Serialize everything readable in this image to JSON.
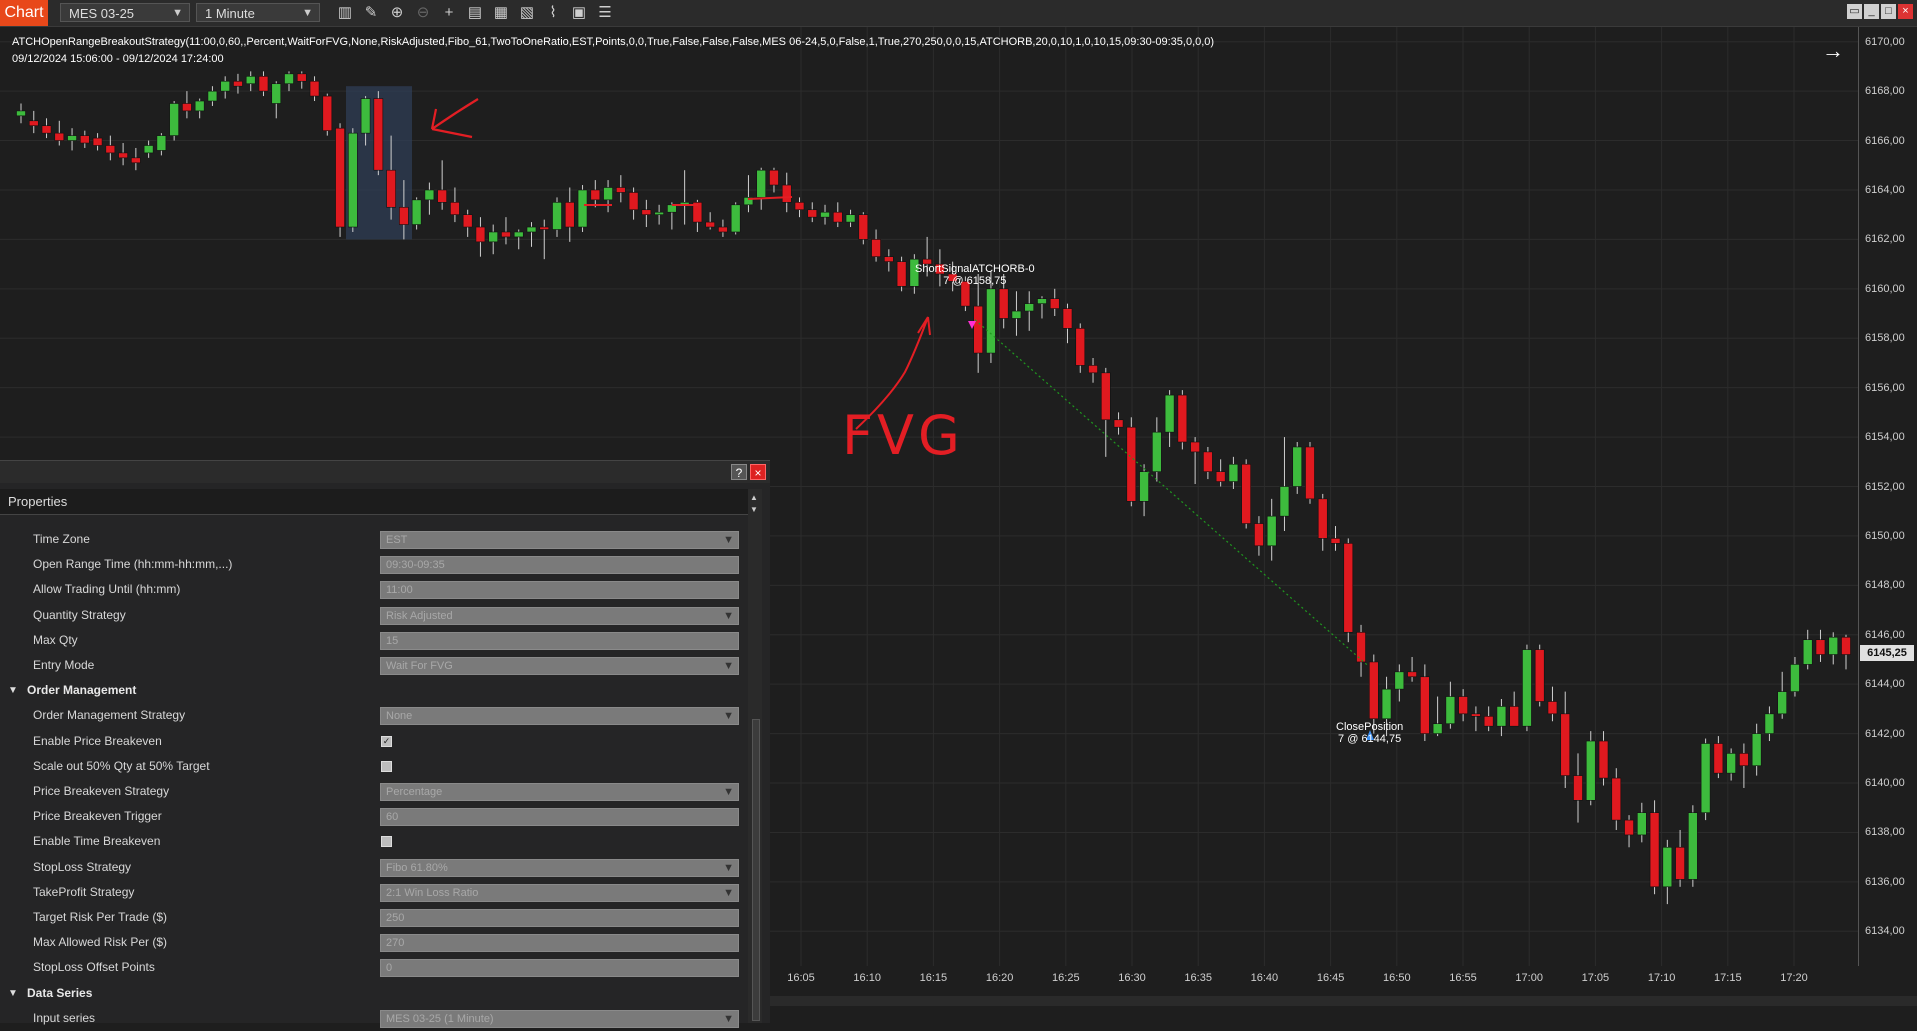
{
  "toolbar": {
    "chart_tab": "Chart",
    "instrument": "MES 03-25",
    "interval": "1 Minute",
    "icons": [
      "bar-style-icon",
      "draw-tool-icon",
      "zoom-in-icon",
      "zoom-out-icon",
      "crosshair-icon",
      "data-box-icon",
      "chart-trader-icon",
      "indicators-icon",
      "strategies-icon",
      "properties-icon",
      "menu-icon"
    ]
  },
  "chart": {
    "strategy_label": "ATCHOpenRangeBreakoutStrategy(11:00,0,60,,Percent,WaitForFVG,None,RiskAdjusted,Fibo_61,TwoToOneRatio,EST,Points,0,0,True,False,False,False,MES 06-24,5,0,False,1,True,270,250,0,0,15,ATCHORB,20,0,10,1,0,10,15,09:30-09:35,0,0,0)",
    "date_range": "09/12/2024 15:06:00 - 09/12/2024 17:24:00",
    "entry_label_1": "ShortSignalATCHORB-0",
    "entry_label_2": "7 @ 6158,75",
    "exit_label_1": "ClosePosition",
    "exit_label_2": "7 @ 6144,75",
    "handwritten_note": "FVG",
    "last_price": "6145,25",
    "colors": {
      "up": "#3dbb3d",
      "down": "#e0191f",
      "annotation": "#e31e24",
      "background": "#1e1e1e",
      "highlight_box": "#2f3d55"
    }
  },
  "chart_data": {
    "type": "candlestick",
    "ylim": [
      6133,
      6171
    ],
    "y_ticks": [
      "6170,00",
      "6168,00",
      "6166,00",
      "6164,00",
      "6162,00",
      "6160,00",
      "6158,00",
      "6156,00",
      "6154,00",
      "6152,00",
      "6150,00",
      "6148,00",
      "6146,00",
      "6144,00",
      "6142,00",
      "6140,00",
      "6138,00",
      "6136,00",
      "6134,00"
    ],
    "x_ticks": [
      "16:05",
      "16:10",
      "16:15",
      "16:20",
      "16:25",
      "16:30",
      "16:35",
      "16:40",
      "16:45",
      "16:50",
      "16:55",
      "17:00",
      "17:05",
      "17:10",
      "17:15",
      "17:20"
    ],
    "ohlc": [
      [
        6167,
        6167.5,
        6166.7,
        6167.2
      ],
      [
        6166.8,
        6167.2,
        6166.3,
        6166.6
      ],
      [
        6166.6,
        6166.9,
        6166.1,
        6166.3
      ],
      [
        6166.3,
        6166.8,
        6165.8,
        6166
      ],
      [
        6166,
        6166.5,
        6165.6,
        6166.2
      ],
      [
        6166.2,
        6166.4,
        6165.7,
        6165.9
      ],
      [
        6166.1,
        6166.3,
        6165.6,
        6165.8
      ],
      [
        6165.8,
        6166.2,
        6165.2,
        6165.5
      ],
      [
        6165.5,
        6165.9,
        6165,
        6165.3
      ],
      [
        6165.3,
        6165.7,
        6164.8,
        6165.1
      ],
      [
        6165.5,
        6166,
        6165.3,
        6165.8
      ],
      [
        6165.6,
        6166.3,
        6165.4,
        6166.2
      ],
      [
        6166.2,
        6167.6,
        6166,
        6167.5
      ],
      [
        6167.5,
        6168,
        6166.9,
        6167.2
      ],
      [
        6167.2,
        6167.7,
        6166.9,
        6167.6
      ],
      [
        6167.6,
        6168.2,
        6167.4,
        6168
      ],
      [
        6168,
        6168.6,
        6167.7,
        6168.4
      ],
      [
        6168.4,
        6168.7,
        6167.9,
        6168.2
      ],
      [
        6168.3,
        6168.8,
        6168,
        6168.6
      ],
      [
        6168.6,
        6168.8,
        6167.8,
        6168
      ],
      [
        6167.5,
        6168.4,
        6166.9,
        6168.3
      ],
      [
        6168.3,
        6168.8,
        6168,
        6168.7
      ],
      [
        6168.7,
        6168.8,
        6168.1,
        6168.4
      ],
      [
        6168.4,
        6168.6,
        6167.6,
        6167.8
      ],
      [
        6167.8,
        6167.9,
        6166.2,
        6166.4
      ],
      [
        6166.5,
        6166.7,
        6162.1,
        6162.5
      ],
      [
        6162.5,
        6166.5,
        6162.3,
        6166.3
      ],
      [
        6166.3,
        6167.8,
        6165.8,
        6167.7
      ],
      [
        6167.7,
        6168,
        6164.6,
        6164.8
      ],
      [
        6164.8,
        6166.2,
        6162.8,
        6163.3
      ],
      [
        6163.3,
        6164.4,
        6162,
        6162.6
      ],
      [
        6162.6,
        6163.7,
        6162.4,
        6163.6
      ],
      [
        6163.6,
        6164.3,
        6163,
        6164
      ],
      [
        6164,
        6165.2,
        6163.2,
        6163.5
      ],
      [
        6163.5,
        6164.1,
        6162.7,
        6163
      ],
      [
        6163,
        6163.2,
        6162.1,
        6162.5
      ],
      [
        6162.5,
        6162.9,
        6161.3,
        6161.9
      ],
      [
        6161.9,
        6162.6,
        6161.4,
        6162.3
      ],
      [
        6162.3,
        6162.9,
        6161.8,
        6162.1
      ],
      [
        6162.1,
        6162.4,
        6161.6,
        6162.3
      ],
      [
        6162.3,
        6162.7,
        6161.7,
        6162.5
      ],
      [
        6162.5,
        6162.8,
        6161.2,
        6162.4
      ],
      [
        6162.4,
        6163.7,
        6162.1,
        6163.5
      ],
      [
        6163.5,
        6164.1,
        6161.9,
        6162.5
      ],
      [
        6162.5,
        6164.2,
        6162.3,
        6164
      ],
      [
        6164,
        6164.4,
        6163.3,
        6163.6
      ],
      [
        6163.6,
        6164.4,
        6163.1,
        6164.1
      ],
      [
        6164.1,
        6164.6,
        6163.5,
        6163.9
      ],
      [
        6163.9,
        6164.1,
        6162.8,
        6163.2
      ],
      [
        6163.2,
        6163.6,
        6162.5,
        6163
      ],
      [
        6163,
        6163.4,
        6162.6,
        6163.1
      ],
      [
        6163.1,
        6163.5,
        6162.4,
        6163.4
      ],
      [
        6163.4,
        6164.8,
        6162.6,
        6163.5
      ],
      [
        6163.5,
        6163.6,
        6162.3,
        6162.7
      ],
      [
        6162.7,
        6163.1,
        6162.4,
        6162.5
      ],
      [
        6162.5,
        6162.8,
        6162.1,
        6162.3
      ],
      [
        6162.3,
        6163.5,
        6162.2,
        6163.4
      ],
      [
        6163.4,
        6164.6,
        6163.1,
        6163.7
      ],
      [
        6163.7,
        6164.9,
        6163.2,
        6164.8
      ],
      [
        6164.8,
        6164.9,
        6163.9,
        6164.2
      ],
      [
        6164.2,
        6164.7,
        6163.1,
        6163.5
      ],
      [
        6163.5,
        6163.7,
        6162.9,
        6163.2
      ],
      [
        6163.2,
        6163.5,
        6162.7,
        6162.9
      ],
      [
        6162.9,
        6163.4,
        6162.6,
        6163.1
      ],
      [
        6163.1,
        6163.5,
        6162.5,
        6162.7
      ],
      [
        6162.7,
        6163.2,
        6162.5,
        6163
      ],
      [
        6163,
        6163.1,
        6161.8,
        6162
      ],
      [
        6162,
        6162.4,
        6161.1,
        6161.3
      ],
      [
        6161.3,
        6161.6,
        6160.7,
        6161.1
      ],
      [
        6161.1,
        6161.3,
        6159.9,
        6160.1
      ],
      [
        6160.1,
        6161.4,
        6159.8,
        6161.2
      ],
      [
        6161.2,
        6162.1,
        6160.5,
        6161
      ],
      [
        6161,
        6161.6,
        6160.1,
        6160.6
      ],
      [
        6160.6,
        6161.1,
        6159.9,
        6160.3
      ],
      [
        6160.3,
        6160.5,
        6159.1,
        6159.3
      ],
      [
        6159.3,
        6160.6,
        6156.6,
        6157.4
      ],
      [
        6157.4,
        6160.7,
        6157,
        6160
      ],
      [
        6160,
        6160.6,
        6158.4,
        6158.8
      ],
      [
        6158.8,
        6159.9,
        6158.1,
        6159.1
      ],
      [
        6159.1,
        6159.9,
        6158.3,
        6159.4
      ],
      [
        6159.4,
        6159.7,
        6158.8,
        6159.6
      ],
      [
        6159.6,
        6160,
        6158.9,
        6159.2
      ],
      [
        6159.2,
        6159.4,
        6157.8,
        6158.4
      ],
      [
        6158.4,
        6158.6,
        6156.6,
        6156.9
      ],
      [
        6156.9,
        6157.2,
        6156.2,
        6156.6
      ],
      [
        6156.6,
        6156.8,
        6153.2,
        6154.7
      ],
      [
        6154.7,
        6155,
        6154.1,
        6154.4
      ],
      [
        6154.4,
        6154.8,
        6151.2,
        6151.4
      ],
      [
        6151.4,
        6152.9,
        6150.8,
        6152.6
      ],
      [
        6152.6,
        6154.8,
        6152.2,
        6154.2
      ],
      [
        6154.2,
        6155.9,
        6153.6,
        6155.7
      ],
      [
        6155.7,
        6155.9,
        6153.5,
        6153.8
      ],
      [
        6153.8,
        6154,
        6152.1,
        6153.4
      ],
      [
        6153.4,
        6153.6,
        6152.3,
        6152.6
      ],
      [
        6152.6,
        6153.1,
        6152,
        6152.2
      ],
      [
        6152.2,
        6153.2,
        6151.9,
        6152.9
      ],
      [
        6152.9,
        6153.1,
        6150.3,
        6150.5
      ],
      [
        6150.5,
        6150.8,
        6149.2,
        6149.6
      ],
      [
        6149.6,
        6151.5,
        6149,
        6150.8
      ],
      [
        6150.8,
        6154,
        6150.2,
        6152
      ],
      [
        6152,
        6153.8,
        6151.7,
        6153.6
      ],
      [
        6153.6,
        6153.8,
        6151.3,
        6151.5
      ],
      [
        6151.5,
        6151.7,
        6149.4,
        6149.9
      ],
      [
        6149.9,
        6150.4,
        6149.4,
        6149.7
      ],
      [
        6149.7,
        6149.9,
        6145.7,
        6146.1
      ],
      [
        6146.1,
        6146.4,
        6144.3,
        6144.9
      ],
      [
        6144.9,
        6145.2,
        6142,
        6142.6
      ],
      [
        6142.6,
        6144.3,
        6141.9,
        6143.8
      ],
      [
        6143.8,
        6144.8,
        6143.3,
        6144.5
      ],
      [
        6144.5,
        6145.1,
        6144.1,
        6144.3
      ],
      [
        6144.3,
        6144.8,
        6141.7,
        6142
      ],
      [
        6142,
        6143.5,
        6141.9,
        6142.4
      ],
      [
        6142.4,
        6144.1,
        6142.2,
        6143.5
      ],
      [
        6143.5,
        6143.8,
        6142.5,
        6142.8
      ],
      [
        6142.8,
        6143.1,
        6142.1,
        6142.7
      ],
      [
        6142.7,
        6143.1,
        6142.1,
        6142.3
      ],
      [
        6142.3,
        6143.4,
        6141.9,
        6143.1
      ],
      [
        6143.1,
        6143.7,
        6142.4,
        6142.3
      ],
      [
        6142.3,
        6145.6,
        6142.1,
        6145.4
      ],
      [
        6145.4,
        6145.6,
        6143.1,
        6143.3
      ],
      [
        6143.3,
        6143.9,
        6142.5,
        6142.8
      ],
      [
        6142.8,
        6143.7,
        6139.8,
        6140.3
      ],
      [
        6140.3,
        6141.2,
        6138.4,
        6139.3
      ],
      [
        6139.3,
        6142.1,
        6139.1,
        6141.7
      ],
      [
        6141.7,
        6142.1,
        6139.9,
        6140.2
      ],
      [
        6140.2,
        6140.6,
        6138.1,
        6138.5
      ],
      [
        6138.5,
        6138.7,
        6137.4,
        6137.9
      ],
      [
        6137.9,
        6139.2,
        6137.6,
        6138.8
      ],
      [
        6138.8,
        6139.3,
        6135.5,
        6135.8
      ],
      [
        6135.8,
        6137.7,
        6135.1,
        6137.4
      ],
      [
        6137.4,
        6138.1,
        6135.8,
        6136.1
      ],
      [
        6136.1,
        6139.1,
        6135.8,
        6138.8
      ],
      [
        6138.8,
        6141.8,
        6138.5,
        6141.6
      ],
      [
        6141.6,
        6141.9,
        6140.2,
        6140.4
      ],
      [
        6140.4,
        6141.4,
        6140.1,
        6141.2
      ],
      [
        6141.2,
        6141.6,
        6139.8,
        6140.7
      ],
      [
        6140.7,
        6142.4,
        6140.3,
        6142
      ],
      [
        6142,
        6143.1,
        6141.7,
        6142.8
      ],
      [
        6142.8,
        6144.5,
        6142.6,
        6143.7
      ],
      [
        6143.7,
        6145.1,
        6143.5,
        6144.8
      ],
      [
        6144.8,
        6146.2,
        6144.6,
        6145.8
      ],
      [
        6145.8,
        6146.2,
        6144.9,
        6145.2
      ],
      [
        6145.2,
        6146.1,
        6144.8,
        6145.9
      ],
      [
        6145.9,
        6146,
        6144.6,
        6145.2
      ]
    ]
  },
  "properties": {
    "title": "Properties",
    "help_button": "?",
    "close_button": "×",
    "rows": [
      {
        "type": "field",
        "label": "Time Zone",
        "value": "EST",
        "dropdown": true
      },
      {
        "type": "field",
        "label": "Open Range Time (hh:mm-hh:mm,...)",
        "value": "09:30-09:35",
        "dropdown": false
      },
      {
        "type": "field",
        "label": "Allow Trading Until (hh:mm)",
        "value": "11:00",
        "dropdown": false
      },
      {
        "type": "field",
        "label": "Quantity Strategy",
        "value": "Risk Adjusted",
        "dropdown": true
      },
      {
        "type": "field",
        "label": "Max Qty",
        "value": "15",
        "dropdown": false
      },
      {
        "type": "field",
        "label": "Entry Mode",
        "value": "Wait For FVG",
        "dropdown": true
      },
      {
        "type": "section",
        "label": "Order Management"
      },
      {
        "type": "field",
        "label": "Order Management Strategy",
        "value": "None",
        "dropdown": true
      },
      {
        "type": "check",
        "label": "Enable Price Breakeven",
        "checked": true
      },
      {
        "type": "check",
        "label": "Scale out 50% Qty at 50% Target",
        "checked": false
      },
      {
        "type": "field",
        "label": "Price Breakeven Strategy",
        "value": "Percentage",
        "dropdown": true
      },
      {
        "type": "field",
        "label": "Price Breakeven Trigger",
        "value": "60",
        "dropdown": false
      },
      {
        "type": "check",
        "label": "Enable Time Breakeven",
        "checked": false
      },
      {
        "type": "field",
        "label": "StopLoss Strategy",
        "value": "Fibo 61.80%",
        "dropdown": true
      },
      {
        "type": "field",
        "label": "TakeProfit Strategy",
        "value": "2:1 Win Loss Ratio",
        "dropdown": true
      },
      {
        "type": "field",
        "label": "Target Risk Per Trade ($)",
        "value": "250",
        "dropdown": false
      },
      {
        "type": "field",
        "label": "Max Allowed Risk Per ($)",
        "value": "270",
        "dropdown": false
      },
      {
        "type": "field",
        "label": "StopLoss Offset Points",
        "value": "0",
        "dropdown": false
      },
      {
        "type": "section",
        "label": "Data Series"
      },
      {
        "type": "field",
        "label": "Input series",
        "value": "MES 03-25 (1 Minute)",
        "dropdown": true
      }
    ]
  }
}
